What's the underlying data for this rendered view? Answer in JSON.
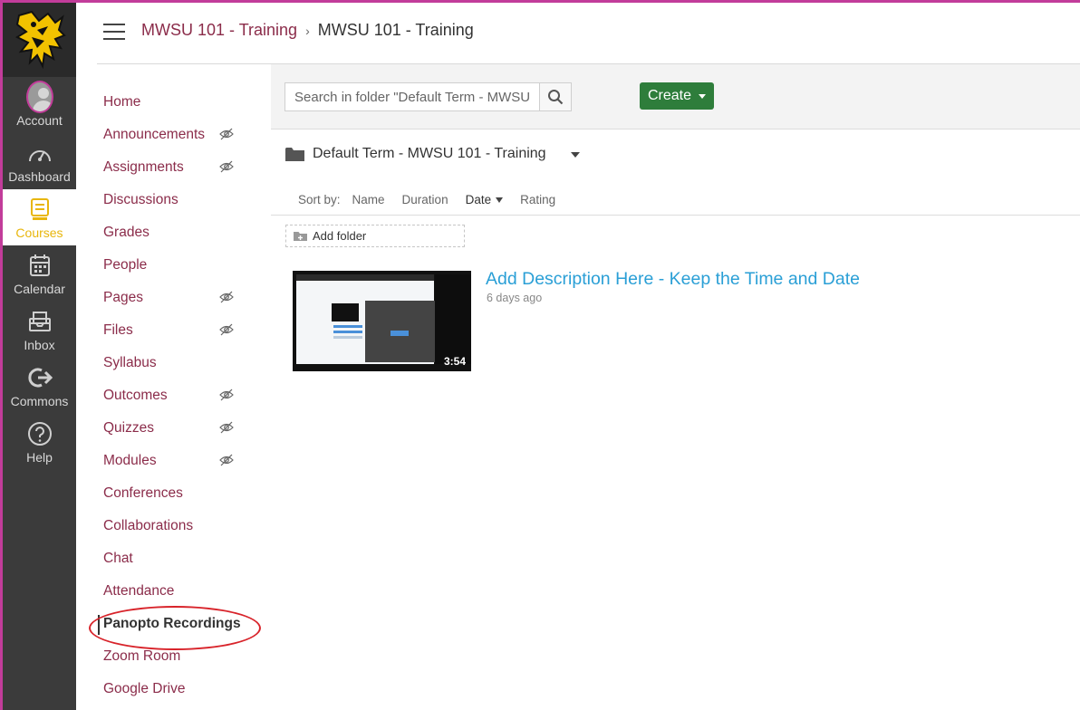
{
  "global_nav": {
    "items": [
      {
        "label": "Account",
        "icon": "avatar-icon"
      },
      {
        "label": "Dashboard",
        "icon": "dashboard-icon"
      },
      {
        "label": "Courses",
        "icon": "courses-icon",
        "active": true
      },
      {
        "label": "Calendar",
        "icon": "calendar-icon"
      },
      {
        "label": "Inbox",
        "icon": "inbox-icon"
      },
      {
        "label": "Commons",
        "icon": "commons-icon"
      },
      {
        "label": "Help",
        "icon": "help-icon"
      }
    ],
    "accent": "#e8b60c",
    "background": "#3b3b3b"
  },
  "breadcrumb": {
    "link": "MWSU 101 - Training",
    "current": "MWSU 101 - Training"
  },
  "course_nav": {
    "items": [
      {
        "label": "Home",
        "hidden_eye": false
      },
      {
        "label": "Announcements",
        "hidden_eye": true
      },
      {
        "label": "Assignments",
        "hidden_eye": true
      },
      {
        "label": "Discussions",
        "hidden_eye": false
      },
      {
        "label": "Grades",
        "hidden_eye": false
      },
      {
        "label": "People",
        "hidden_eye": false
      },
      {
        "label": "Pages",
        "hidden_eye": true
      },
      {
        "label": "Files",
        "hidden_eye": true
      },
      {
        "label": "Syllabus",
        "hidden_eye": false
      },
      {
        "label": "Outcomes",
        "hidden_eye": true
      },
      {
        "label": "Quizzes",
        "hidden_eye": true
      },
      {
        "label": "Modules",
        "hidden_eye": true
      },
      {
        "label": "Conferences",
        "hidden_eye": false
      },
      {
        "label": "Collaborations",
        "hidden_eye": false
      },
      {
        "label": "Chat",
        "hidden_eye": false
      },
      {
        "label": "Attendance",
        "hidden_eye": false
      },
      {
        "label": "Panopto Recordings",
        "hidden_eye": false,
        "active": true
      },
      {
        "label": "Zoom Room",
        "hidden_eye": false
      },
      {
        "label": "Google Drive",
        "hidden_eye": false
      }
    ],
    "link_color": "#8b2c4a"
  },
  "panopto": {
    "search": {
      "placeholder": "Search in folder \"Default Term - MWSU ..."
    },
    "create_label": "Create",
    "folder_name": "Default Term - MWSU 101 - Training",
    "sort": {
      "label": "Sort by:",
      "options": [
        "Name",
        "Duration",
        "Date",
        "Rating"
      ],
      "selected": "Date"
    },
    "add_folder_label": "Add folder",
    "sessions": [
      {
        "title": "Add Description Here - Keep the Time and Date",
        "date": "6 days ago",
        "duration": "3:54"
      }
    ],
    "create_color": "#2e7d3b",
    "title_color": "#2a9fd6"
  }
}
